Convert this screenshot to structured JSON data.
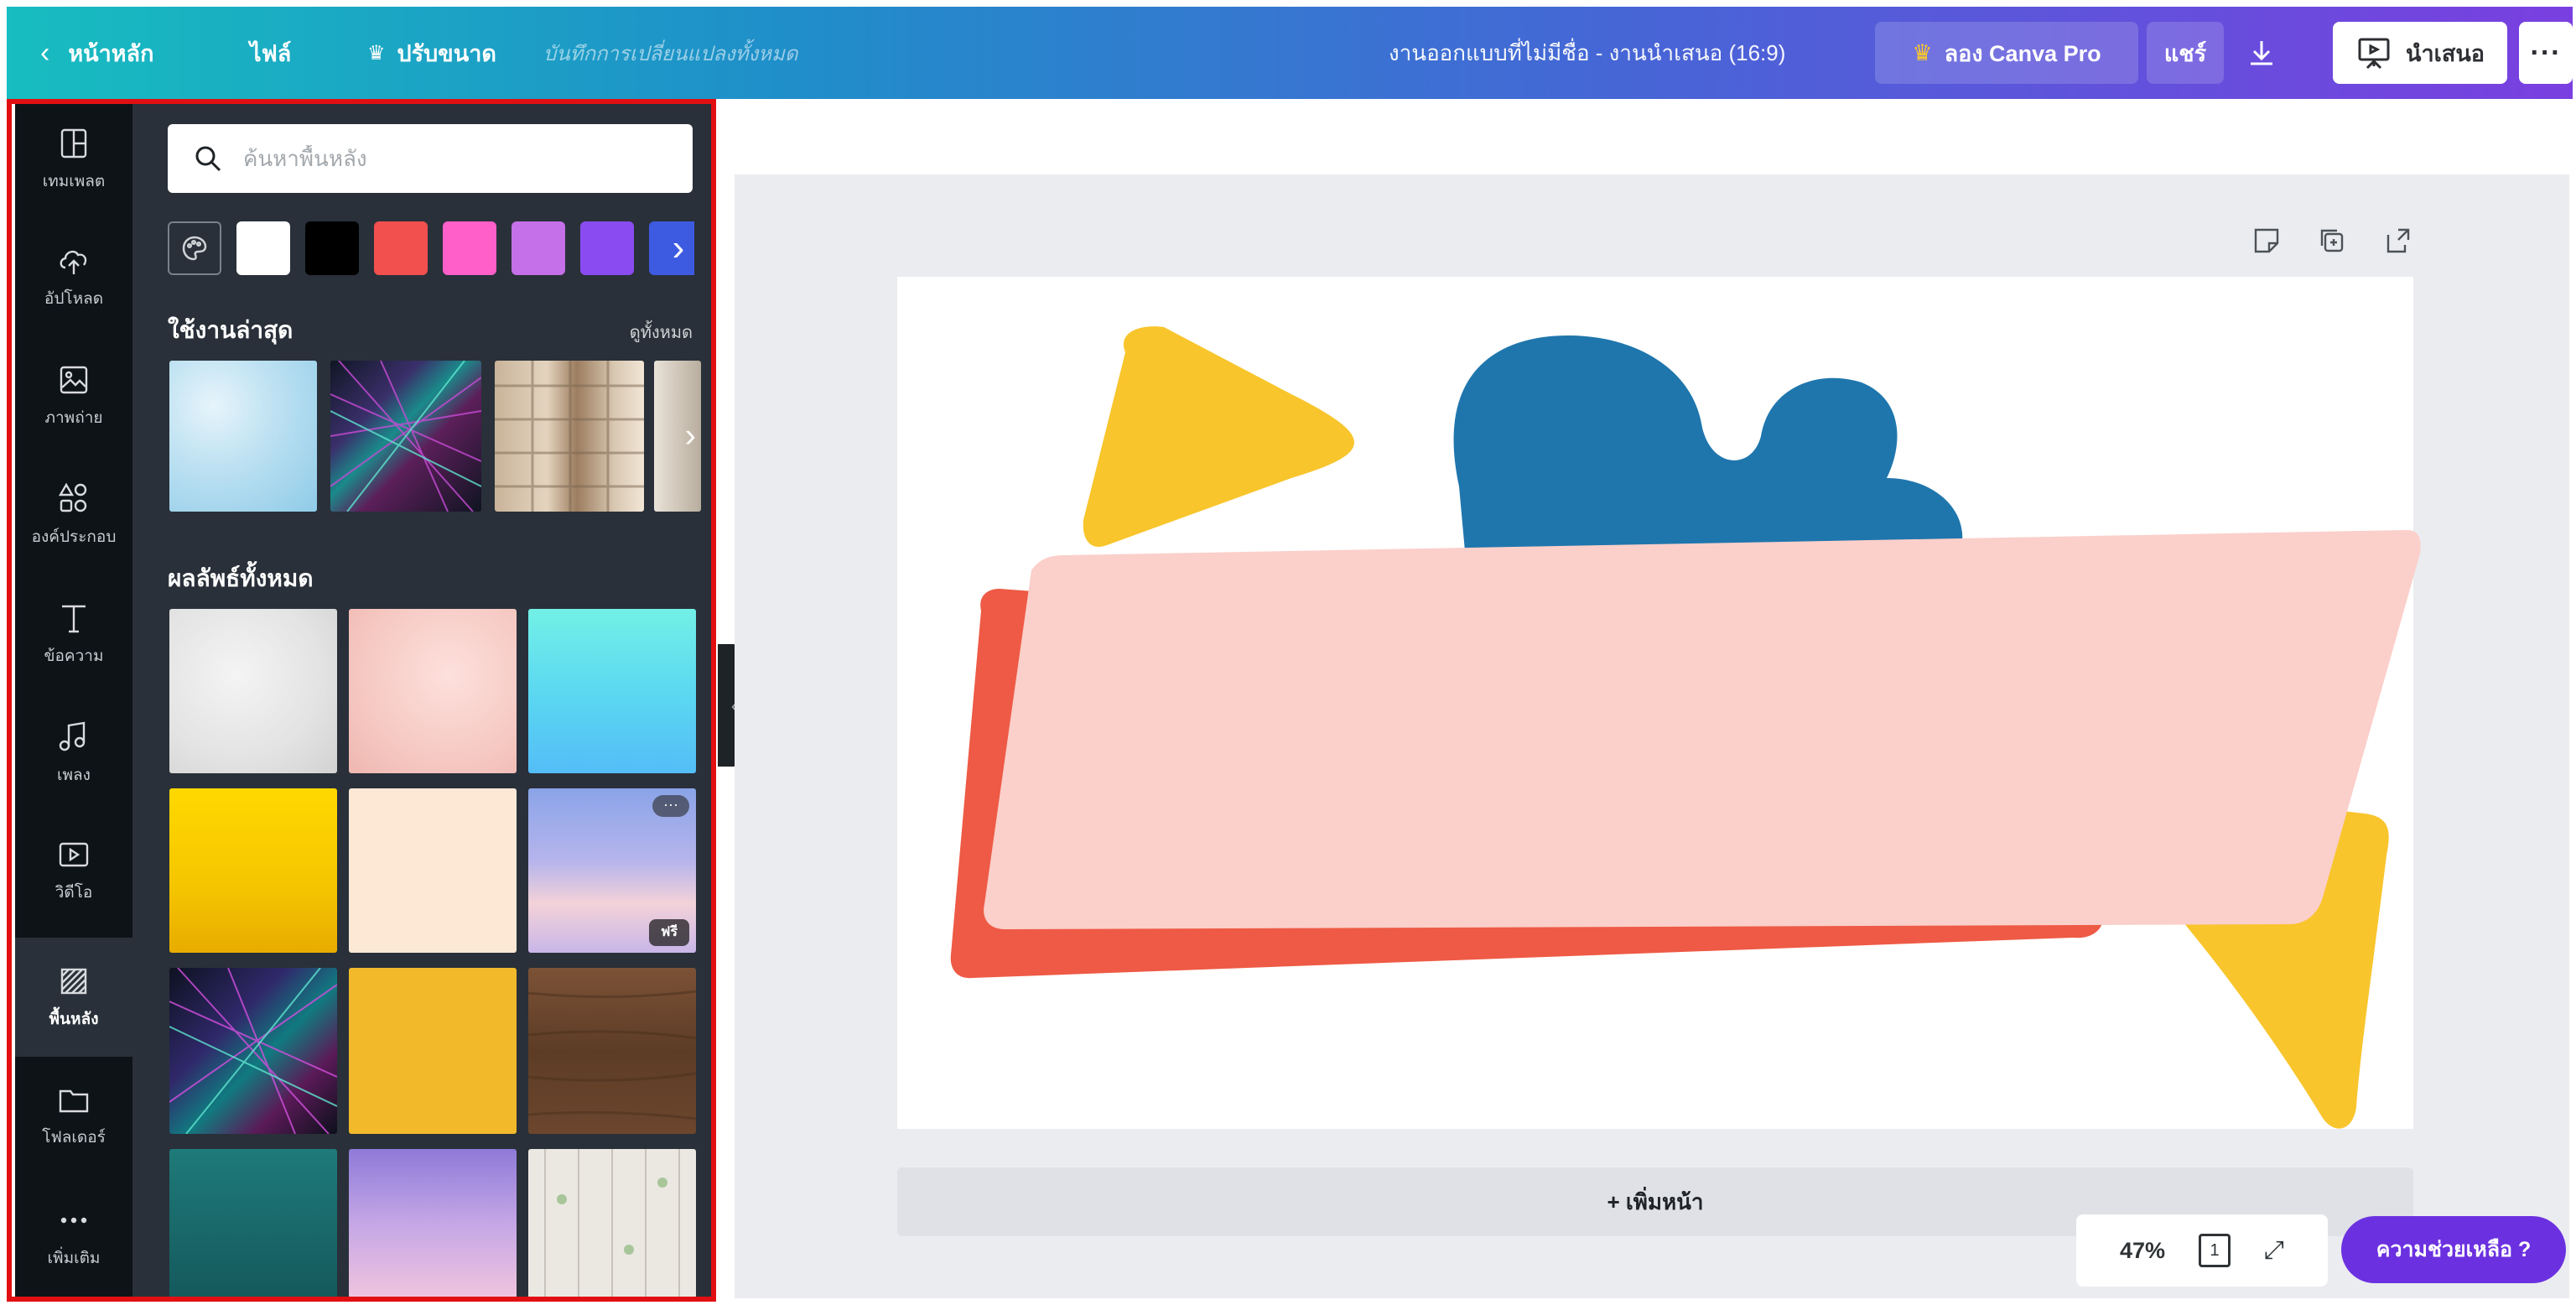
{
  "topbar": {
    "home_label": "หน้าหลัก",
    "file_label": "ไฟล์",
    "resize_label": "ปรับขนาด",
    "saved_status": "บันทึกการเปลี่ยนแปลงทั้งหมด",
    "doc_title": "งานออกแบบที่ไม่มีชื่อ - งานนำเสนอ (16:9)",
    "try_pro_label": "ลอง Canva Pro",
    "share_label": "แชร์",
    "present_label": "นำเสนอ",
    "more_label": "···",
    "crown_color": "#ffc928"
  },
  "rail": {
    "items": [
      {
        "label": "เทมเพลต",
        "icon": "template-icon"
      },
      {
        "label": "อัปโหลด",
        "icon": "upload-cloud-icon"
      },
      {
        "label": "ภาพถ่าย",
        "icon": "photo-icon"
      },
      {
        "label": "องค์ประกอบ",
        "icon": "elements-icon"
      },
      {
        "label": "ข้อความ",
        "icon": "text-icon"
      },
      {
        "label": "เพลง",
        "icon": "music-icon"
      },
      {
        "label": "วิดีโอ",
        "icon": "video-icon"
      },
      {
        "label": "พื้นหลัง",
        "icon": "background-icon"
      },
      {
        "label": "โฟลเดอร์",
        "icon": "folder-icon"
      },
      {
        "label": "เพิ่มเติม",
        "icon": "more-icon"
      }
    ],
    "active_index": 7
  },
  "panel": {
    "search_placeholder": "ค้นหาพื้นหลัง",
    "swatches": [
      "#ffffff",
      "#000000",
      "#f24f4f",
      "#ff5fc8",
      "#c56fe8",
      "#8a4cf0",
      "#3d5be0"
    ],
    "recent_heading": "ใช้งานล่าสุด",
    "see_all_label": "ดูทั้งหมด",
    "all_heading": "ผลลัพธ์ทั้งหมด",
    "badge_label": "ฟรี",
    "dots_label": "···"
  },
  "canvas": {
    "add_page_label": "+ เพิ่มหน้า",
    "zoom_value": "47%",
    "page_number": "1",
    "help_label": "ความช่วยเหลือ ?",
    "colors": {
      "yellow": "#f8c52c",
      "blue": "#1f76ad",
      "red": "#ee5a45",
      "pink": "#fbcfca"
    }
  }
}
